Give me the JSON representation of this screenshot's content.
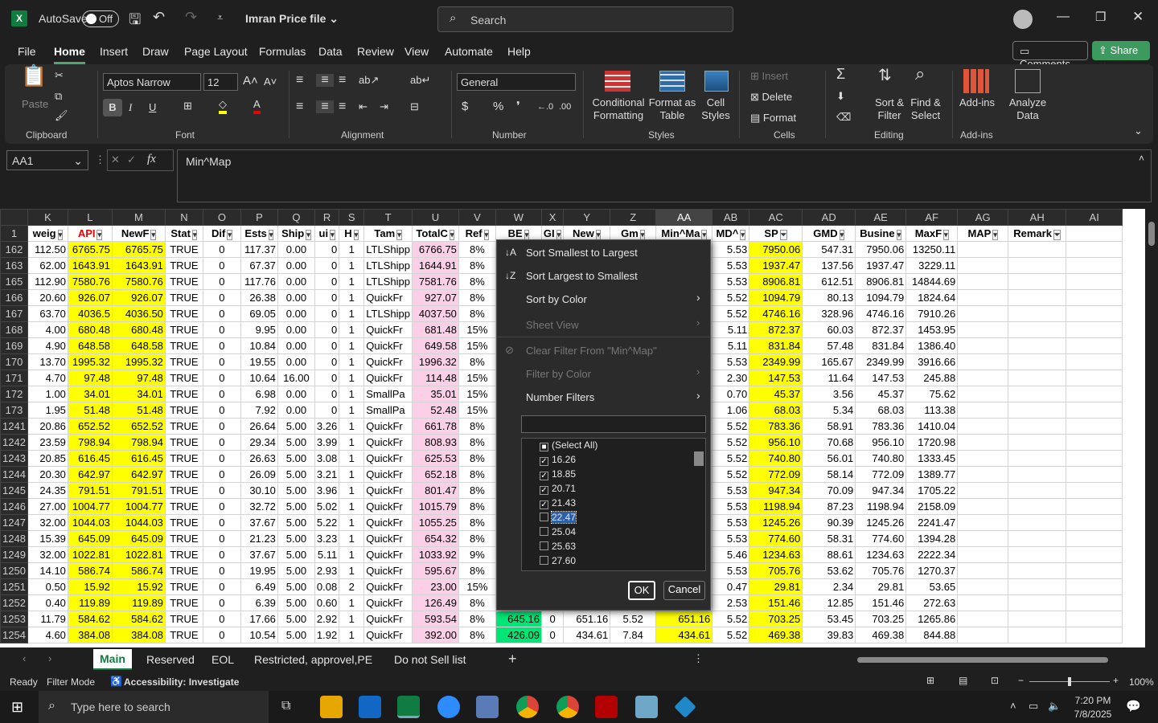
{
  "title": {
    "autosave": "AutoSave",
    "toggle": "Off",
    "file": "Imran Price file",
    "search": "Search"
  },
  "menus": [
    "File",
    "Home",
    "Insert",
    "Draw",
    "Page Layout",
    "Formulas",
    "Data",
    "Review",
    "View",
    "Automate",
    "Help"
  ],
  "top_buttons": {
    "comments": "Comments",
    "share": "Share"
  },
  "ribbon": {
    "font_name": "Aptos Narrow",
    "font_size": "12",
    "number_format": "General",
    "groups": {
      "clipboard": "Clipboard",
      "font": "Font",
      "alignment": "Alignment",
      "number": "Number",
      "styles": "Styles",
      "cells": "Cells",
      "editing": "Editing",
      "addins": "Add-ins"
    },
    "paste": "Paste",
    "cond": "Conditional Formatting",
    "fmt_table": "Format as Table",
    "cell_styles": "Cell Styles",
    "insert": "Insert",
    "delete": "Delete",
    "format": "Format",
    "sort": "Sort & Filter",
    "find": "Find & Select",
    "addins_btn": "Add-ins",
    "analyze": "Analyze Data"
  },
  "formula": {
    "namebox": "AA1",
    "fx": "fx",
    "content": "Min^Map"
  },
  "columns": [
    "K",
    "L",
    "M",
    "N",
    "O",
    "P",
    "Q",
    "R",
    "S",
    "T",
    "U",
    "V",
    "W",
    "X",
    "Y",
    "Z",
    "AA",
    "AB",
    "AC",
    "AD",
    "AE",
    "AF",
    "AG",
    "AH",
    "AI"
  ],
  "headers": [
    "weig",
    "API",
    "NewF",
    "Stat",
    "Dif",
    "Ests",
    "Ship",
    "ui",
    "H",
    "Tam",
    "TotalC",
    "Ref",
    "BE",
    "GI",
    "New",
    "Gm",
    "Min^Ma",
    "MD^",
    "SP",
    "GMD",
    "Busine",
    "MaxF",
    "MAP",
    "Remark",
    ""
  ],
  "rows": [
    {
      "rn": "162",
      "v": [
        "112.50",
        "6765.75",
        "6765.75",
        "TRUE",
        "0",
        "117.37",
        "0.00",
        "0",
        "1",
        "LTLShipp",
        "6766.75",
        "8%",
        "",
        "",
        "",
        "",
        "",
        "5.53",
        "7950.06",
        "547.31",
        "7950.06",
        "13250.11",
        "",
        ""
      ]
    },
    {
      "rn": "163",
      "v": [
        "62.00",
        "1643.91",
        "1643.91",
        "TRUE",
        "0",
        "67.37",
        "0.00",
        "0",
        "1",
        "LTLShipp",
        "1644.91",
        "8%",
        "",
        "",
        "",
        "",
        "",
        "5.53",
        "1937.47",
        "137.56",
        "1937.47",
        "3229.11",
        "",
        ""
      ]
    },
    {
      "rn": "165",
      "v": [
        "112.90",
        "7580.76",
        "7580.76",
        "TRUE",
        "0",
        "117.76",
        "0.00",
        "0",
        "1",
        "LTLShipp",
        "7581.76",
        "8%",
        "",
        "",
        "",
        "",
        "",
        "5.53",
        "8906.81",
        "612.51",
        "8906.81",
        "14844.69",
        "",
        ""
      ]
    },
    {
      "rn": "166",
      "v": [
        "20.60",
        "926.07",
        "926.07",
        "TRUE",
        "0",
        "26.38",
        "0.00",
        "0",
        "1",
        "QuickFr",
        "927.07",
        "8%",
        "",
        "",
        "",
        "",
        "",
        "5.52",
        "1094.79",
        "80.13",
        "1094.79",
        "1824.64",
        "",
        ""
      ]
    },
    {
      "rn": "167",
      "v": [
        "63.70",
        "4036.5",
        "4036.50",
        "TRUE",
        "0",
        "69.05",
        "0.00",
        "0",
        "1",
        "LTLShipp",
        "4037.50",
        "8%",
        "",
        "",
        "",
        "",
        "",
        "5.52",
        "4746.16",
        "328.96",
        "4746.16",
        "7910.26",
        "",
        ""
      ]
    },
    {
      "rn": "168",
      "v": [
        "4.00",
        "680.48",
        "680.48",
        "TRUE",
        "0",
        "9.95",
        "0.00",
        "0",
        "1",
        "QuickFr",
        "681.48",
        "15%",
        "",
        "",
        "",
        "",
        "",
        "5.11",
        "872.37",
        "60.03",
        "872.37",
        "1453.95",
        "",
        ""
      ]
    },
    {
      "rn": "169",
      "v": [
        "4.90",
        "648.58",
        "648.58",
        "TRUE",
        "0",
        "10.84",
        "0.00",
        "0",
        "1",
        "QuickFr",
        "649.58",
        "15%",
        "",
        "",
        "",
        "",
        "",
        "5.11",
        "831.84",
        "57.48",
        "831.84",
        "1386.40",
        "",
        ""
      ]
    },
    {
      "rn": "170",
      "v": [
        "13.70",
        "1995.32",
        "1995.32",
        "TRUE",
        "0",
        "19.55",
        "0.00",
        "0",
        "1",
        "QuickFr",
        "1996.32",
        "8%",
        "",
        "",
        "",
        "",
        "",
        "5.53",
        "2349.99",
        "165.67",
        "2349.99",
        "3916.66",
        "",
        ""
      ]
    },
    {
      "rn": "171",
      "v": [
        "4.70",
        "97.48",
        "97.48",
        "TRUE",
        "0",
        "10.64",
        "16.00",
        "0",
        "1",
        "QuickFr",
        "114.48",
        "15%",
        "",
        "",
        "",
        "",
        "",
        "2.30",
        "147.53",
        "11.64",
        "147.53",
        "245.88",
        "",
        ""
      ]
    },
    {
      "rn": "172",
      "v": [
        "1.00",
        "34.01",
        "34.01",
        "TRUE",
        "0",
        "6.98",
        "0.00",
        "0",
        "1",
        "SmallPa",
        "35.01",
        "15%",
        "",
        "",
        "",
        "",
        "",
        "0.70",
        "45.37",
        "3.56",
        "45.37",
        "75.62",
        "",
        ""
      ]
    },
    {
      "rn": "173",
      "v": [
        "1.95",
        "51.48",
        "51.48",
        "TRUE",
        "0",
        "7.92",
        "0.00",
        "0",
        "1",
        "SmallPa",
        "52.48",
        "15%",
        "",
        "",
        "",
        "",
        "",
        "1.06",
        "68.03",
        "5.34",
        "68.03",
        "113.38",
        "",
        ""
      ]
    },
    {
      "rn": "1241",
      "v": [
        "20.86",
        "652.52",
        "652.52",
        "TRUE",
        "0",
        "26.64",
        "5.00",
        "3.26",
        "1",
        "QuickFr",
        "661.78",
        "8%",
        "",
        "",
        "",
        "",
        "",
        "5.52",
        "783.36",
        "58.91",
        "783.36",
        "1410.04",
        "",
        ""
      ]
    },
    {
      "rn": "1242",
      "v": [
        "23.59",
        "798.94",
        "798.94",
        "TRUE",
        "0",
        "29.34",
        "5.00",
        "3.99",
        "1",
        "QuickFr",
        "808.93",
        "8%",
        "",
        "",
        "",
        "",
        "",
        "5.52",
        "956.10",
        "70.68",
        "956.10",
        "1720.98",
        "",
        ""
      ]
    },
    {
      "rn": "1243",
      "v": [
        "20.85",
        "616.45",
        "616.45",
        "TRUE",
        "0",
        "26.63",
        "5.00",
        "3.08",
        "1",
        "QuickFr",
        "625.53",
        "8%",
        "",
        "",
        "",
        "",
        "",
        "5.52",
        "740.80",
        "56.01",
        "740.80",
        "1333.45",
        "",
        ""
      ]
    },
    {
      "rn": "1244",
      "v": [
        "20.30",
        "642.97",
        "642.97",
        "TRUE",
        "0",
        "26.09",
        "5.00",
        "3.21",
        "1",
        "QuickFr",
        "652.18",
        "8%",
        "",
        "",
        "",
        "",
        "",
        "5.52",
        "772.09",
        "58.14",
        "772.09",
        "1389.77",
        "",
        ""
      ]
    },
    {
      "rn": "1245",
      "v": [
        "24.35",
        "791.51",
        "791.51",
        "TRUE",
        "0",
        "30.10",
        "5.00",
        "3.96",
        "1",
        "QuickFr",
        "801.47",
        "8%",
        "",
        "",
        "",
        "",
        "",
        "5.53",
        "947.34",
        "70.09",
        "947.34",
        "1705.22",
        "",
        ""
      ]
    },
    {
      "rn": "1246",
      "v": [
        "27.00",
        "1004.77",
        "1004.77",
        "TRUE",
        "0",
        "32.72",
        "5.00",
        "5.02",
        "1",
        "QuickFr",
        "1015.79",
        "8%",
        "",
        "",
        "",
        "",
        "",
        "5.53",
        "1198.94",
        "87.23",
        "1198.94",
        "2158.09",
        "",
        ""
      ]
    },
    {
      "rn": "1247",
      "v": [
        "32.00",
        "1044.03",
        "1044.03",
        "TRUE",
        "0",
        "37.67",
        "5.00",
        "5.22",
        "1",
        "QuickFr",
        "1055.25",
        "8%",
        "",
        "",
        "",
        "",
        "",
        "5.53",
        "1245.26",
        "90.39",
        "1245.26",
        "2241.47",
        "",
        ""
      ]
    },
    {
      "rn": "1248",
      "v": [
        "15.39",
        "645.09",
        "645.09",
        "TRUE",
        "0",
        "21.23",
        "5.00",
        "3.23",
        "1",
        "QuickFr",
        "654.32",
        "8%",
        "",
        "",
        "",
        "",
        "",
        "5.53",
        "774.60",
        "58.31",
        "774.60",
        "1394.28",
        "",
        ""
      ]
    },
    {
      "rn": "1249",
      "v": [
        "32.00",
        "1022.81",
        "1022.81",
        "TRUE",
        "0",
        "37.67",
        "5.00",
        "5.11",
        "1",
        "QuickFr",
        "1033.92",
        "9%",
        "",
        "",
        "",
        "",
        "",
        "5.46",
        "1234.63",
        "88.61",
        "1234.63",
        "2222.34",
        "",
        ""
      ]
    },
    {
      "rn": "1250",
      "v": [
        "14.10",
        "586.74",
        "586.74",
        "TRUE",
        "0",
        "19.95",
        "5.00",
        "2.93",
        "1",
        "QuickFr",
        "595.67",
        "8%",
        "",
        "",
        "",
        "",
        "",
        "5.53",
        "705.76",
        "53.62",
        "705.76",
        "1270.37",
        "",
        ""
      ]
    },
    {
      "rn": "1251",
      "v": [
        "0.50",
        "15.92",
        "15.92",
        "TRUE",
        "0",
        "6.49",
        "5.00",
        "0.08",
        "2",
        "QuickFr",
        "23.00",
        "15%",
        "",
        "",
        "",
        "",
        "",
        "0.47",
        "29.81",
        "2.34",
        "29.81",
        "53.65",
        "",
        ""
      ]
    },
    {
      "rn": "1252",
      "v": [
        "0.40",
        "119.89",
        "119.89",
        "TRUE",
        "0",
        "6.39",
        "5.00",
        "0.60",
        "1",
        "QuickFr",
        "126.49",
        "8%",
        "",
        "",
        "",
        "",
        "",
        "2.53",
        "151.46",
        "12.85",
        "151.46",
        "272.63",
        "",
        ""
      ]
    },
    {
      "rn": "1253",
      "v": [
        "11.79",
        "584.62",
        "584.62",
        "TRUE",
        "0",
        "17.66",
        "5.00",
        "2.92",
        "1",
        "QuickFr",
        "593.54",
        "8%",
        "645.16",
        "0",
        "651.16",
        "5.52",
        "651.16",
        "5.52",
        "703.25",
        "53.45",
        "703.25",
        "1265.86",
        "",
        ""
      ]
    },
    {
      "rn": "1254",
      "v": [
        "4.60",
        "384.08",
        "384.08",
        "TRUE",
        "0",
        "10.54",
        "5.00",
        "1.92",
        "1",
        "QuickFr",
        "392.00",
        "8%",
        "426.09",
        "0",
        "434.61",
        "7.84",
        "434.61",
        "5.52",
        "469.38",
        "39.83",
        "469.38",
        "844.88",
        "",
        ""
      ]
    }
  ],
  "dropdown": {
    "sort_asc": "Sort Smallest to Largest",
    "sort_desc": "Sort Largest to Smallest",
    "sort_color": "Sort by Color",
    "sheet_view": "Sheet View",
    "clear": "Clear Filter From \"Min^Map\"",
    "filter_color": "Filter by Color",
    "number_filters": "Number Filters",
    "items": [
      {
        "label": "(Select All)",
        "state": "partial"
      },
      {
        "label": "16.26",
        "state": "checked"
      },
      {
        "label": "18.85",
        "state": "checked"
      },
      {
        "label": "20.71",
        "state": "checked"
      },
      {
        "label": "21.43",
        "state": "checked"
      },
      {
        "label": "22.47",
        "state": "unchecked"
      },
      {
        "label": "25.04",
        "state": "unchecked"
      },
      {
        "label": "25.63",
        "state": "unchecked"
      },
      {
        "label": "27.60",
        "state": "unchecked"
      }
    ],
    "ok": "OK",
    "cancel": "Cancel"
  },
  "sheets": [
    "Main",
    "Reserved",
    "EOL",
    "Restricted, approvel,PE",
    "Do not Sell list"
  ],
  "status": {
    "ready": "Ready",
    "mode": "Filter Mode",
    "access": "Accessibility: Investigate",
    "zoom": "100%"
  },
  "taskbar": {
    "search": "Type here to search",
    "time": "7:20 PM",
    "date": "7/8/2025"
  }
}
